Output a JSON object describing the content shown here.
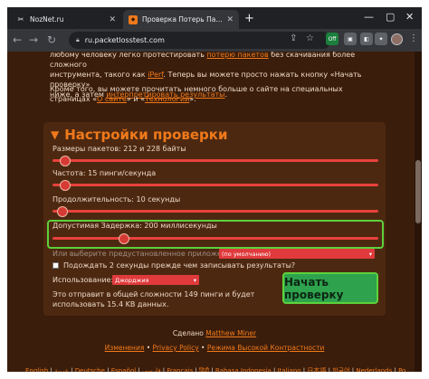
{
  "browser": {
    "tabs": [
      {
        "title": "NozNet.ru",
        "favicon": "scissors-favicon"
      },
      {
        "title": "Проверка Потерь Пакетов – Пр",
        "favicon": "packetloss-favicon"
      }
    ],
    "url": "ru.packetlosstest.com",
    "extension_badge": "Off"
  },
  "intro": {
    "line1_pre": "любому человеку легко протестировать ",
    "line1_link": "потерю пакетов",
    "line1_post": " без скачивания более сложного",
    "line2_pre": "инструмента, такого как ",
    "line2_link": "iPerf",
    "line2_post": ". Теперь вы можете просто нажать кнопку «Начать проверку»",
    "line3_pre": "ниже, а затем ",
    "line3_link": "интерпретировать результаты",
    "line3_post": ".",
    "more_pre": "Кроме того, вы можете прочитать немного больше о сайте на специальных страницах «",
    "more_link1": "О сайте",
    "more_mid": "» и «",
    "more_link2": "Технологии",
    "more_post": "»."
  },
  "settings": {
    "title": "Настройки проверки",
    "packet_size_label": "Размеры пакетов: 212 и 228 байты",
    "frequency_label": "Частота: 15 пинги/секунда",
    "duration_label": "Продолжительность: 10 секунды",
    "latency_label": "Допустимая Задержка: 200 миллисекунды",
    "sliders": {
      "packet_size": 0.04,
      "frequency": 0.04,
      "duration": 0.03,
      "latency": 0.22
    },
    "preset_label": "Или выберите предустановленное приложение:",
    "preset_value": "(по умолчанию)",
    "wait_label": "Подождать 2 секунды прежде чем записывать результаты?",
    "server_label": "Использование:",
    "server_value": "Джорджия",
    "summary_line1": "Это отправит в общей сложности 149 пинги и будет",
    "summary_line2": "использовать 15.4 KB данных.",
    "start_button": "Начать проверку"
  },
  "footer": {
    "made_by_pre": "Сделано ",
    "made_by_link": "Matthew Miner",
    "links": [
      "Изменения",
      "Privacy Policy",
      "Режима Высокой Контрастности"
    ],
    "sep": " • ",
    "languages": [
      "English",
      "عربية",
      "Deutsche",
      "Español",
      "فارسی",
      "Français",
      "हिंदी",
      "Bahasa Indonesia",
      "Italiano",
      "日本語",
      "한국어",
      "Nederlands",
      "Polski"
    ]
  }
}
